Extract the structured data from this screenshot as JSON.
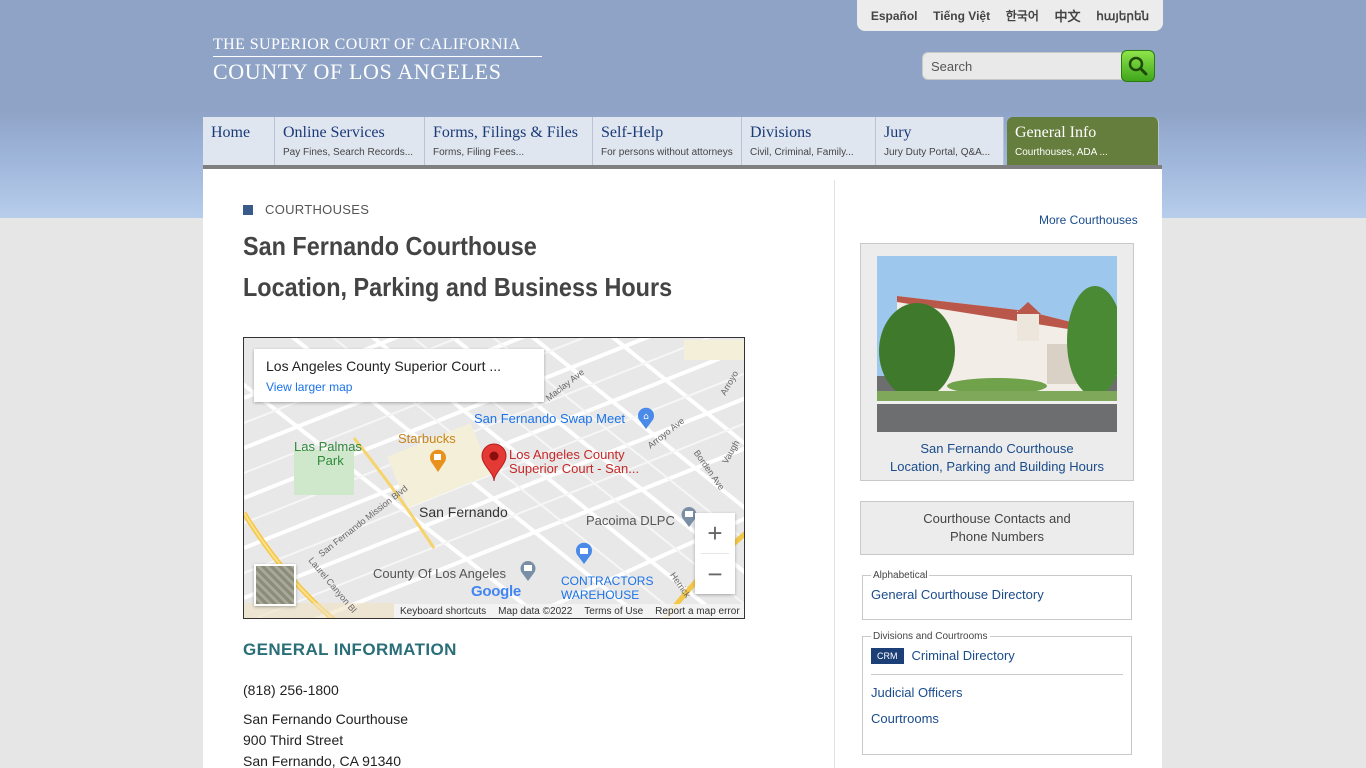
{
  "header": {
    "logo_line1": "THE SUPERIOR COURT OF CALIFORNIA",
    "logo_line2": "COUNTY OF LOS ANGELES",
    "languages": [
      "Español",
      "Tiếng Việt",
      "한국어",
      "中文",
      "հայերեն"
    ],
    "search_placeholder": "Search"
  },
  "nav": [
    {
      "title": "Home",
      "sub": ""
    },
    {
      "title": "Online Services",
      "sub": "Pay Fines, Search Records..."
    },
    {
      "title": "Forms, Filings & Files",
      "sub": "Forms, Filing Fees..."
    },
    {
      "title": "Self-Help",
      "sub": "For persons without attorneys"
    },
    {
      "title": "Divisions",
      "sub": "Civil, Criminal, Family..."
    },
    {
      "title": "Jury",
      "sub": "Jury Duty Portal, Q&A..."
    },
    {
      "title": "General Info",
      "sub": "Courthouses, ADA ..."
    }
  ],
  "main": {
    "breadcrumb": "COURTHOUSES",
    "title_line1": "San Fernando Courthouse",
    "title_line2": "Location, Parking and Business Hours",
    "map": {
      "card_name": "Los Angeles County Superior Court ...",
      "card_link": "View larger map",
      "labels": {
        "swap_meet": "San Fernando Swap Meet",
        "las_palmas_1": "Las Palmas",
        "las_palmas_2": "Park",
        "starbucks": "Starbucks",
        "court_1": "Los Angeles County",
        "court_2": "Superior Court - San...",
        "city": "San Fernando",
        "pacoima": "Pacoima DLPC",
        "county": "County Of Los Angeles",
        "contractors_1": "CONTRACTORS",
        "contractors_2": "WAREHOUSE",
        "maclay": "Maclay Ave",
        "arroyo": "Arroyo Ave",
        "arroyo2": "Arroyo",
        "borden": "Borden Ave",
        "vaughn": "Vaugh",
        "mission": "San Fernando Mission Blvd",
        "laurel": "Laurel Canyon Bl",
        "herrick": "Herrick"
      },
      "google": "Google",
      "zoom_in": "+",
      "zoom_out": "−",
      "footer": [
        "Keyboard shortcuts",
        "Map data ©2022",
        "Terms of Use",
        "Report a map error"
      ]
    },
    "section_heading": "GENERAL INFORMATION",
    "phone": "(818) 256-1800",
    "address": [
      "San Fernando Courthouse",
      "900 Third Street",
      "San Fernando, CA 91340"
    ]
  },
  "sidebar": {
    "more_link": "More Courthouses",
    "photo_caption_1": "San Fernando Courthouse",
    "photo_caption_2": "Location, Parking and Building Hours",
    "contacts_1": "Courthouse Contacts and",
    "contacts_2": "Phone Numbers",
    "alpha_legend": "Alphabetical",
    "alpha_link": "General Courthouse Directory",
    "div_legend": "Divisions and Courtrooms",
    "crm_badge": "CRM",
    "criminal_link": "Criminal Directory",
    "judicial_link": "Judicial Officers",
    "courtrooms_link": "Courtrooms"
  },
  "colors": {
    "header_blue": "#8ea3c6",
    "nav_active": "#657d3d",
    "link_blue": "#1a4c8c",
    "heading_teal": "#2a6e78"
  }
}
